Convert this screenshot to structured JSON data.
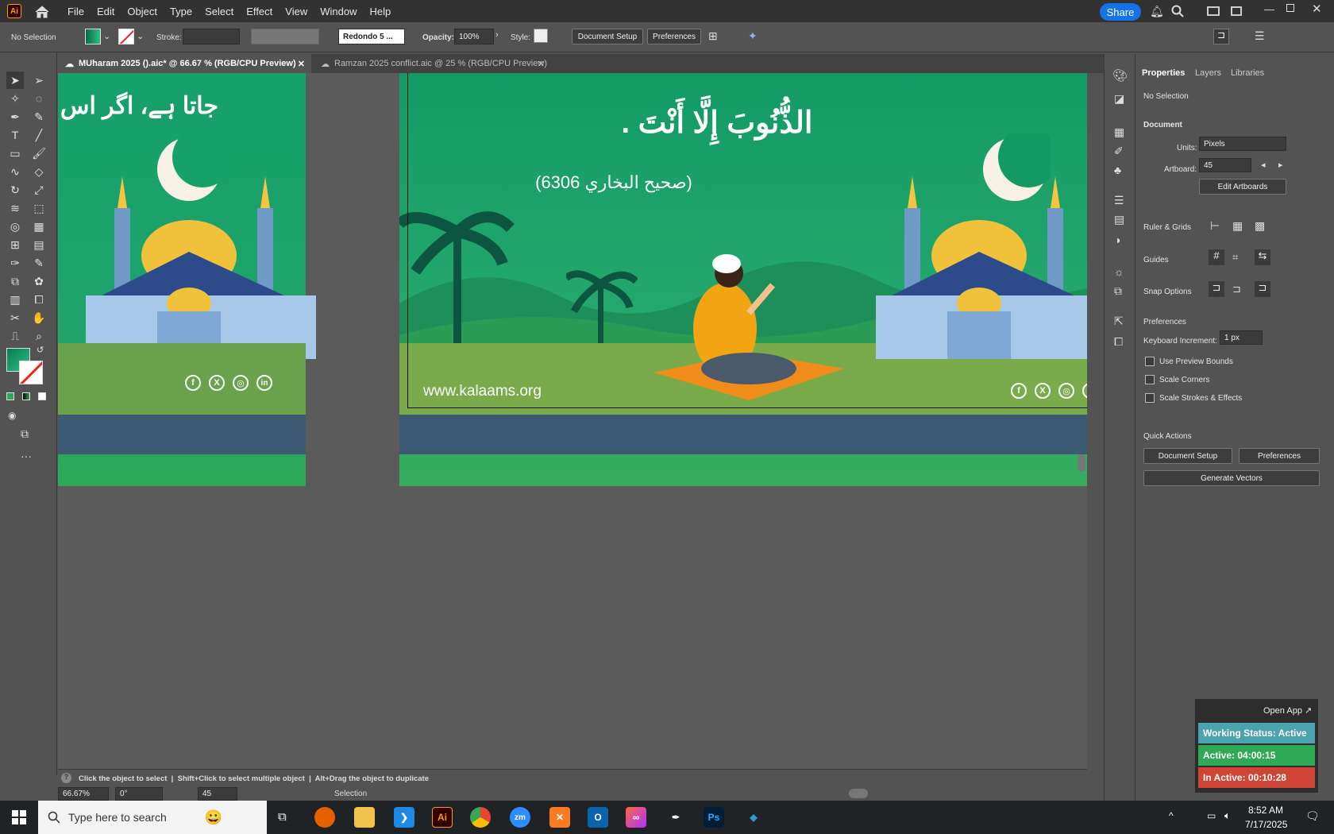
{
  "menubar": {
    "app_icon": "Ai",
    "items": [
      "File",
      "Edit",
      "Object",
      "Type",
      "Select",
      "Effect",
      "View",
      "Window",
      "Help"
    ],
    "share_label": "Share"
  },
  "control": {
    "selection_label": "No Selection",
    "stroke_label": "Stroke:",
    "brush_value": "Redondo 5 ...",
    "opacity_label": "Opacity:",
    "opacity_value": "100%",
    "style_label": "Style:",
    "document_setup": "Document Setup",
    "preferences": "Preferences"
  },
  "tabs": [
    {
      "label": "MUharam 2025 ().aic* @ 66.67 % (RGB/CPU Preview)",
      "active": true
    },
    {
      "label": "Ramzan 2025 conflict.aic @ 25 % (RGB/CPU Preview)",
      "active": false
    }
  ],
  "artboard": {
    "left_urdu_line": "جاتا ہے، اگر اس",
    "arabic_line": "الذُّنُوبَ إِلَّا أَنْتَ .",
    "citation": "(صحيح البخاري 6306)",
    "website": "www.kalaams.org",
    "social_icons": [
      "facebook-icon",
      "x-icon",
      "instagram-icon",
      "linkedin-icon"
    ]
  },
  "statusbar": {
    "hint": "Click the object to select  |  Shift+Click to select multiple object  |  Alt+Drag the object to duplicate",
    "zoom": "66.67%",
    "rotation": "0°",
    "artboard_num": "45",
    "tool": "Selection"
  },
  "properties": {
    "tabs": [
      "Properties",
      "Layers",
      "Libraries"
    ],
    "no_selection": "No Selection",
    "document_title": "Document",
    "units_label": "Units:",
    "units_value": "Pixels",
    "artboard_label": "Artboard:",
    "artboard_value": "45",
    "edit_artboards": "Edit Artboards",
    "ruler_grids": "Ruler & Grids",
    "guides": "Guides",
    "snap_options": "Snap Options",
    "preferences_title": "Preferences",
    "keyboard_increment_label": "Keyboard Increment:",
    "keyboard_increment_value": "1 px",
    "checkboxes": [
      "Use Preview Bounds",
      "Scale Corners",
      "Scale Strokes & Effects"
    ],
    "quick_actions": "Quick Actions",
    "qa_document_setup": "Document Setup",
    "qa_preferences": "Preferences",
    "qa_generate_vectors": "Generate Vectors"
  },
  "widget": {
    "open_app": "Open App ↗",
    "working_status": "Working Status: Active",
    "active_time": "Active: 04:00:15",
    "inactive_time": "In Active: 00:10:28",
    "colors": {
      "status": "#4aa3ad",
      "active": "#2eaa57",
      "inactive": "#d04436"
    }
  },
  "taskbar": {
    "search_placeholder": "Type here to search",
    "time": "8:52 AM",
    "date": "7/17/2025",
    "apps": [
      "firefox-icon",
      "file-explorer-icon",
      "vscode-icon",
      "illustrator-icon",
      "chrome-icon",
      "zoom-icon",
      "xampp-icon",
      "outlook-icon",
      "creative-cloud-icon",
      "pen-tool-icon",
      "photoshop-icon",
      "app-icon"
    ]
  },
  "colors": {
    "accent": "#1473e6",
    "art_green": "#1ea36b",
    "ui_dark": "#323232",
    "ui_mid": "#535353"
  }
}
